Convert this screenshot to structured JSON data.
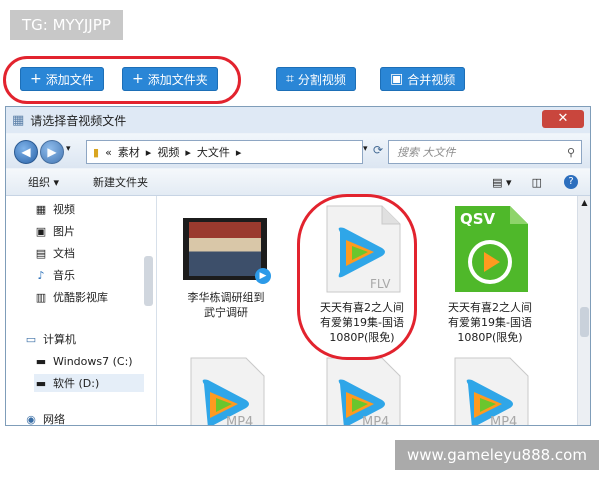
{
  "watermark": {
    "tg": "TG: MYYJJPP",
    "site": "www.gameleyu888.com"
  },
  "toolbar": {
    "add_file": "添加文件",
    "add_folder": "添加文件夹",
    "split": "分割视频",
    "merge": "合并视频"
  },
  "dialog": {
    "title": "请选择音视频文件",
    "close": "✕",
    "breadcrumb": [
      "«",
      "素材",
      "视频",
      "大文件"
    ],
    "search_placeholder": "搜索 大文件",
    "organize": "组织 ▾",
    "new_folder": "新建文件夹"
  },
  "sidebar": {
    "libraries": [
      "视频",
      "图片",
      "文档",
      "音乐",
      "优酷影视库"
    ],
    "computer": "计算机",
    "drives": [
      "Windows7 (C:)",
      "软件 (D:)"
    ],
    "network": "网络"
  },
  "files": [
    {
      "name_lines": [
        "李华栋调研组到",
        "武宁调研"
      ],
      "type": "thumbnail"
    },
    {
      "name_lines": [
        "天天有喜2之人间",
        "有爱第19集-国语",
        "1080P(限免)"
      ],
      "type": "FLV"
    },
    {
      "name_lines": [
        "天天有喜2之人间",
        "有爱第19集-国语",
        "1080P(限免)"
      ],
      "type": "QSV"
    },
    {
      "name_lines": [],
      "type": "MP4"
    },
    {
      "name_lines": [],
      "type": "MP4"
    },
    {
      "name_lines": [],
      "type": "MP4"
    }
  ],
  "colors": {
    "accent": "#2a86d6",
    "annotation": "#e2232e"
  }
}
